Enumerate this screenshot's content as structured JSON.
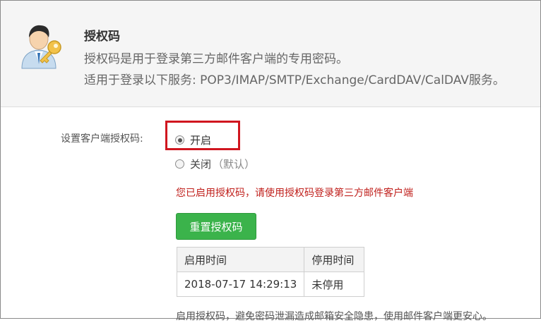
{
  "header": {
    "title": "授权码",
    "description_line1": "授权码是用于登录第三方邮件客户端的专用密码。",
    "description_line2": "适用于登录以下服务: POP3/IMAP/SMTP/Exchange/CardDAV/CalDAV服务。"
  },
  "setting": {
    "label": "设置客户端授权码:",
    "options": [
      {
        "label": "开启",
        "selected": true
      },
      {
        "label": "关闭",
        "suffix": "（默认）",
        "selected": false
      }
    ]
  },
  "notice": "您已启用授权码，请使用授权码登录第三方邮件客户端",
  "reset_button": "重置授权码",
  "table": {
    "headers": [
      "启用时间",
      "停用时间"
    ],
    "rows": [
      [
        "2018-07-17 14:29:13",
        "未停用"
      ]
    ]
  },
  "footnote": "启用授权码，避免密码泄漏造成邮箱安全隐患，使用邮件客户端更安心。",
  "colors": {
    "accent_green": "#3bb34b",
    "notice_red": "#c0201c",
    "highlight_red": "#d0161f"
  },
  "icons": {
    "avatar": "user-key-icon"
  }
}
